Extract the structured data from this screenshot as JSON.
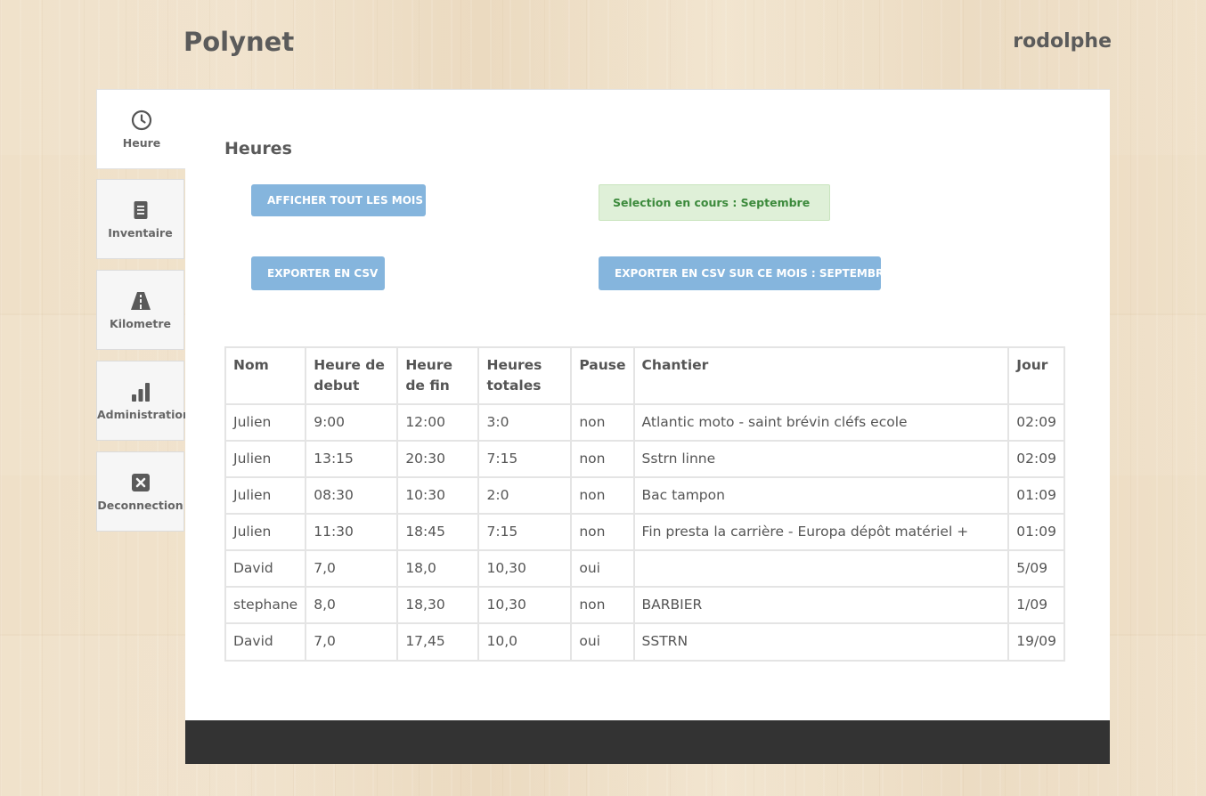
{
  "header": {
    "app_title": "Polynet",
    "user_name": "rodolphe"
  },
  "sidebar": {
    "items": [
      {
        "label": "Heure",
        "icon": "clock-icon",
        "active": true
      },
      {
        "label": "Inventaire",
        "icon": "document-icon",
        "active": false
      },
      {
        "label": "Kilometre",
        "icon": "road-icon",
        "active": false
      },
      {
        "label": "Administration",
        "icon": "bar-chart-icon",
        "active": false
      },
      {
        "label": "Deconnection",
        "icon": "close-box-icon",
        "active": false
      }
    ]
  },
  "main": {
    "title": "Heures",
    "show_all_months_label": "AFFICHER TOUT LES MOIS",
    "selection_text": "Selection en cours : Septembre",
    "export_csv_label": "EXPORTER EN CSV",
    "export_month_label": "EXPORTER EN CSV SUR CE MOIS : SEPTEMBRE"
  },
  "table": {
    "headers": [
      "Nom",
      "Heure de debut",
      "Heure de fin",
      "Heures totales",
      "Pause",
      "Chantier",
      "Jour"
    ],
    "rows": [
      [
        "Julien",
        "9:00",
        "12:00",
        "3:0",
        "non",
        "Atlantic moto - saint brévin cléfs ecole",
        "02:09"
      ],
      [
        "Julien",
        "13:15",
        "20:30",
        "7:15",
        "non",
        "Sstrn linne",
        "02:09"
      ],
      [
        "Julien",
        "08:30",
        "10:30",
        "2:0",
        "non",
        "Bac tampon",
        "01:09"
      ],
      [
        "Julien",
        "11:30",
        "18:45",
        "7:15",
        "non",
        "Fin presta la carrière - Europa dépôt matériel +",
        "01:09"
      ],
      [
        "David",
        "7,0",
        "18,0",
        "10,30",
        "oui",
        "",
        "5/09"
      ],
      [
        "stephane",
        "8,0",
        "18,30",
        "10,30",
        "non",
        "BARBIER",
        "1/09"
      ],
      [
        "David",
        "7,0",
        "17,45",
        "10,0",
        "oui",
        "SSTRN",
        "19/09"
      ]
    ]
  },
  "colors": {
    "button": "#85b5dd",
    "selection_bg": "#dff0d8",
    "selection_text": "#3c8a3c",
    "footer": "#333333"
  }
}
